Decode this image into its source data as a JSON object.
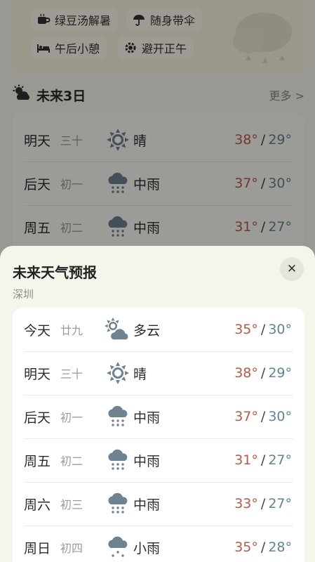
{
  "tips": [
    {
      "icon": "cup-icon",
      "label": "绿豆汤解暑"
    },
    {
      "icon": "umbrella-icon",
      "label": "随身带伞"
    },
    {
      "icon": "bed-icon",
      "label": "午后小憩"
    },
    {
      "icon": "gear-icon",
      "label": "避开正午"
    }
  ],
  "section": {
    "title": "未来3日",
    "more": "更多 >"
  },
  "preview": [
    {
      "day": "明天",
      "lunar": "三十",
      "icon": "sun-icon",
      "cond": "晴",
      "hi": "38°",
      "lo": "29°"
    },
    {
      "day": "后天",
      "lunar": "初一",
      "icon": "rain-icon",
      "cond": "中雨",
      "hi": "37°",
      "lo": "30°"
    },
    {
      "day": "周五",
      "lunar": "初二",
      "icon": "rain-icon",
      "cond": "中雨",
      "hi": "31°",
      "lo": "27°"
    }
  ],
  "sheet": {
    "title": "未来天气预报",
    "subtitle": "深圳",
    "close": "✕"
  },
  "forecast": [
    {
      "day": "今天",
      "lunar": "廿九",
      "icon": "partly-cloudy-icon",
      "cond": "多云",
      "hi": "35°",
      "lo": "30°"
    },
    {
      "day": "明天",
      "lunar": "三十",
      "icon": "sun-icon",
      "cond": "晴",
      "hi": "38°",
      "lo": "29°"
    },
    {
      "day": "后天",
      "lunar": "初一",
      "icon": "rain-icon",
      "cond": "中雨",
      "hi": "37°",
      "lo": "30°"
    },
    {
      "day": "周五",
      "lunar": "初二",
      "icon": "rain-icon",
      "cond": "中雨",
      "hi": "31°",
      "lo": "27°"
    },
    {
      "day": "周六",
      "lunar": "初三",
      "icon": "rain-icon",
      "cond": "中雨",
      "hi": "33°",
      "lo": "27°"
    },
    {
      "day": "周日",
      "lunar": "初四",
      "icon": "rain-icon",
      "cond": "小雨",
      "hi": "35°",
      "lo": "28°"
    }
  ],
  "separator": "/",
  "colors": {
    "high": "#b8594a",
    "low": "#5f8594",
    "icon": "#6f8290"
  }
}
